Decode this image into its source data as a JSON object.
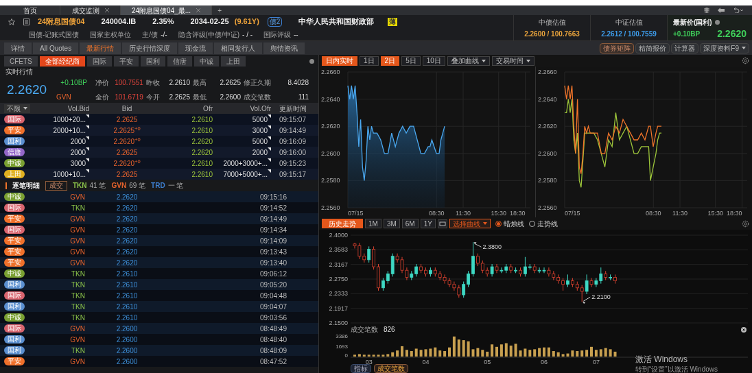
{
  "top_tabs": [
    {
      "label": "首页",
      "closable": false,
      "selected": false
    },
    {
      "label": "成交监测",
      "closable": true,
      "selected": false
    },
    {
      "label": "24附息国债04_最...",
      "closable": true,
      "selected": true
    }
  ],
  "add_tab": "+",
  "bond": {
    "name": "24附息国债04",
    "code": "240004.IB",
    "coupon": "2.35%",
    "maturity": "2034-02-25",
    "term": "(9.61Y)",
    "tag": "债2",
    "issuer": "中华人民共和国财政部",
    "issuer_badge": "薄"
  },
  "bond_info": [
    {
      "label": "国债-记账式国债"
    },
    {
      "label": "国家主权单位"
    },
    {
      "label": "主/债",
      "value": "-/-"
    },
    {
      "label": "隐含评级(中债/中证)",
      "value": "- / -"
    },
    {
      "label": "国际评级",
      "value": "--"
    }
  ],
  "valuations": [
    {
      "label": "中债估值",
      "value": "2.2600 / 100.7663",
      "color": "#e8a33c"
    },
    {
      "label": "中证估值",
      "value": "2.2612 / 100.7559",
      "color": "#3d9be9"
    }
  ],
  "latest": {
    "label": "最新价(国利)",
    "change": "+0.10BP",
    "price": "2.2620"
  },
  "tabs": [
    {
      "label": "详情",
      "selected": false
    },
    {
      "label": "All Quotes",
      "selected": false
    },
    {
      "label": "最新行情",
      "selected": true
    },
    {
      "label": "历史行情深度",
      "selected": false
    },
    {
      "label": "现金流",
      "selected": false
    },
    {
      "label": "相同发行人",
      "selected": false
    },
    {
      "label": "舆情资讯",
      "selected": false
    }
  ],
  "tools": [
    {
      "label": "债券矩阵",
      "highlighted": true,
      "dropdown": false
    },
    {
      "label": "精简报价",
      "highlighted": false,
      "dropdown": false
    },
    {
      "label": "计算器",
      "highlighted": false,
      "dropdown": false
    },
    {
      "label": "深度资料F9",
      "highlighted": false,
      "dropdown": true
    }
  ],
  "brokers": [
    {
      "label": "CFETS",
      "selected": false
    },
    {
      "label": "全部经纪商",
      "selected": true
    },
    {
      "label": "国际",
      "selected": false
    },
    {
      "label": "平安",
      "selected": false
    },
    {
      "label": "国利",
      "selected": false
    },
    {
      "label": "信唐",
      "selected": false
    },
    {
      "label": "中诚",
      "selected": false
    },
    {
      "label": "上田",
      "selected": false
    }
  ],
  "realtime": {
    "title": "实时行情",
    "price": "2.2620",
    "change": "+0.10BP",
    "side": "GVN",
    "stats": [
      {
        "label": "净价",
        "value": "100.7551",
        "kind": "price"
      },
      {
        "label": "昨收",
        "value": "2.2610",
        "kind": "plain"
      },
      {
        "label": "最高",
        "value": "2.2625",
        "kind": "plain"
      },
      {
        "label": "修正久期",
        "value": "8.4028",
        "kind": "plain"
      },
      {
        "label": "全价",
        "value": "101.6719",
        "kind": "price"
      },
      {
        "label": "今开",
        "value": "2.2625",
        "kind": "plain"
      },
      {
        "label": "最低",
        "value": "2.2600",
        "kind": "plain"
      },
      {
        "label": "成交笔数",
        "value": "111",
        "kind": "plain"
      }
    ]
  },
  "quotes": {
    "filter": "不限",
    "columns": [
      "Vol.Bid",
      "Bid",
      "Ofr",
      "Vol.Ofr",
      "更新时间"
    ],
    "rows": [
      {
        "broker": "国际",
        "color": "#d9646e",
        "vol_bid": "1000+20...",
        "bid": "2.2625",
        "ofr": "2.2610",
        "vol_ofr": "5000",
        "time": "09:15:07"
      },
      {
        "broker": "平安",
        "color": "#f0702a",
        "vol_bid": "2000+10...",
        "bid": "2.2625$^{+0}$",
        "ofr": "2.2610",
        "vol_ofr": "3000",
        "time": "09:14:49"
      },
      {
        "broker": "国利",
        "color": "#5a8fd0",
        "vol_bid": "2000",
        "bid": "2.2620$^{+0}$",
        "ofr": "2.2620",
        "vol_ofr": "5000",
        "time": "09:16:09"
      },
      {
        "broker": "信唐",
        "color": "#9366c8",
        "vol_bid": "2000",
        "bid": "2.2625",
        "ofr": "2.2620",
        "vol_ofr": "2000",
        "time": "09:16:00"
      },
      {
        "broker": "中诚",
        "color": "#7aa032",
        "vol_bid": "3000",
        "bid": "2.2620$^{+0}$",
        "ofr": "2.2610",
        "vol_ofr": "2000+3000+...",
        "time": "09:15:23"
      },
      {
        "broker": "上田",
        "color": "#e0b020",
        "vol_bid": "1000+10...",
        "bid": "2.2625",
        "ofr": "2.2610",
        "vol_ofr": "7000+5000+...",
        "time": "09:15:17"
      }
    ]
  },
  "trades": {
    "title": "逐笔明细",
    "button": "成交",
    "summary": [
      {
        "side": "TKN",
        "count": "41 笔",
        "color": "#8bc34a"
      },
      {
        "side": "GVN",
        "count": "69 笔",
        "color": "#e8632c"
      },
      {
        "side": "TRD",
        "count": "一 笔",
        "color": "#3d7fd0"
      }
    ],
    "rows": [
      {
        "broker": "中诚",
        "color": "#7aa032",
        "side": "GVN",
        "kind": "given",
        "price": "2.2620",
        "time": "09:15:16"
      },
      {
        "broker": "国际",
        "color": "#d9646e",
        "side": "TKN",
        "kind": "taken",
        "price": "2.2620",
        "time": "09:14:52"
      },
      {
        "broker": "平安",
        "color": "#f0702a",
        "side": "GVN",
        "kind": "given",
        "price": "2.2620",
        "time": "09:14:49"
      },
      {
        "broker": "国际",
        "color": "#d9646e",
        "side": "GVN",
        "kind": "given",
        "price": "2.2620",
        "time": "09:14:34"
      },
      {
        "broker": "平安",
        "color": "#f0702a",
        "side": "GVN",
        "kind": "given",
        "price": "2.2620",
        "time": "09:14:09"
      },
      {
        "broker": "平安",
        "color": "#f0702a",
        "side": "GVN",
        "kind": "given",
        "price": "2.2620",
        "time": "09:13:43"
      },
      {
        "broker": "平安",
        "color": "#f0702a",
        "side": "GVN",
        "kind": "given",
        "price": "2.2620",
        "time": "09:13:40"
      },
      {
        "broker": "中诚",
        "color": "#7aa032",
        "side": "TKN",
        "kind": "taken",
        "price": "2.2610",
        "time": "09:06:12"
      },
      {
        "broker": "国利",
        "color": "#5a8fd0",
        "side": "TKN",
        "kind": "taken",
        "price": "2.2610",
        "time": "09:05:20"
      },
      {
        "broker": "国际",
        "color": "#d9646e",
        "side": "TKN",
        "kind": "taken",
        "price": "2.2610",
        "time": "09:04:48"
      },
      {
        "broker": "国利",
        "color": "#5a8fd0",
        "side": "TKN",
        "kind": "taken",
        "price": "2.2610",
        "time": "09:04:07"
      },
      {
        "broker": "中诚",
        "color": "#7aa032",
        "side": "TKN",
        "kind": "taken",
        "price": "2.2610",
        "time": "09:03:56"
      },
      {
        "broker": "国际",
        "color": "#d9646e",
        "side": "GVN",
        "kind": "given",
        "price": "2.2600",
        "time": "08:48:49"
      },
      {
        "broker": "国利",
        "color": "#5a8fd0",
        "side": "GVN",
        "kind": "given",
        "price": "2.2600",
        "time": "08:48:40"
      },
      {
        "broker": "国利",
        "color": "#5a8fd0",
        "side": "TKN",
        "kind": "taken",
        "price": "2.2600",
        "time": "08:48:09"
      },
      {
        "broker": "平安",
        "color": "#f0702a",
        "side": "GVN",
        "kind": "given",
        "price": "2.2600",
        "time": "08:47:52"
      }
    ]
  },
  "intraday": {
    "ranges": [
      {
        "label": "日内实时",
        "selected": true
      },
      {
        "label": "1日",
        "selected": false
      },
      {
        "label": "2日",
        "selected": true
      },
      {
        "label": "5日",
        "selected": false
      },
      {
        "label": "10日",
        "selected": false
      }
    ],
    "menus": [
      "叠加曲线",
      "交易时间"
    ],
    "charts": [
      {
        "chart_data": {
          "type": "area",
          "grid": true,
          "x": [
            -1.5,
            -1.29,
            -1.09,
            -0.88,
            -0.68,
            -0.47,
            -0.27,
            -0.06,
            0.15,
            0.35,
            0.56,
            0.76,
            0.97,
            1.17,
            1.38,
            1.59,
            1.79,
            2.2,
            2.62,
            3.03,
            3.44,
            3.85,
            4.26,
            4.67,
            5.08,
            5.5,
            5.91,
            6.32,
            6.73,
            7.14,
            7.55,
            7.76,
            7.97,
            8.48,
            8.79,
            8.99,
            9.2,
            9.41
          ],
          "xlim": [
            -1.5,
            19.08
          ],
          "ylim": [
            2.256,
            2.266
          ],
          "xticks": [
            {
              "value": -1.5,
              "label": "07/15"
            },
            {
              "value": 8.5,
              "label": "08:30"
            },
            {
              "value": 11.5,
              "label": "11:30"
            },
            {
              "value": 15.5,
              "label": "15:30"
            },
            {
              "value": 18.5,
              "label": "18:30"
            }
          ],
          "yticks": [
            {
              "value": 2.256,
              "label": "2.2560"
            },
            {
              "value": 2.258,
              "label": "2.2580"
            },
            {
              "value": 2.26,
              "label": "2.2600"
            },
            {
              "value": 2.262,
              "label": "2.2620"
            },
            {
              "value": 2.264,
              "label": "2.2640"
            },
            {
              "value": 2.266,
              "label": "2.2660"
            }
          ],
          "series": [
            {
              "color": "#4aa8f0",
              "values": [
                2.265,
                2.264,
                2.265,
                2.264,
                2.265,
                2.263,
                2.2605,
                2.2625,
                2.259,
                2.258,
                2.2595,
                2.262,
                2.261,
                2.262,
                2.2615,
                2.2615,
                2.2615,
                2.261,
                2.26,
                2.26,
                2.2615,
                2.2605,
                2.2615,
                2.262,
                2.2615,
                2.262,
                2.262,
                2.261,
                2.26,
                2.26,
                2.2605,
                2.2605,
                2.261,
                2.26,
                2.26,
                2.261,
                2.2615,
                2.262
              ]
            }
          ]
        }
      },
      {
        "chart_data": {
          "type": "line",
          "grid": true,
          "x": [
            -1.5,
            -1.29,
            -1.09,
            -0.88,
            -0.68,
            -0.47,
            -0.27,
            -0.06,
            0.15,
            0.35,
            0.56,
            0.76,
            0.97,
            1.17,
            1.38,
            1.59,
            1.79,
            2.2,
            2.62,
            3.03,
            3.44,
            3.85,
            4.26,
            4.67,
            5.08,
            5.5,
            5.91,
            6.32,
            6.73,
            7.14,
            7.55,
            7.76,
            7.97,
            8.17,
            8.48,
            8.79,
            8.99,
            9.2,
            9.41
          ],
          "xlim": [
            -1.5,
            19.08
          ],
          "ylim": [
            2.256,
            2.266
          ],
          "xticks": [
            {
              "value": -1.5,
              "label": "07/15"
            },
            {
              "value": 8.5,
              "label": "08:30"
            },
            {
              "value": 11.5,
              "label": "11:30"
            },
            {
              "value": 15.5,
              "label": "15:30"
            },
            {
              "value": 18.5,
              "label": "18:30"
            }
          ],
          "yticks": [
            {
              "value": 2.256,
              "label": "2.2560"
            },
            {
              "value": 2.258,
              "label": "2.2580"
            },
            {
              "value": 2.26,
              "label": "2.2600"
            },
            {
              "value": 2.262,
              "label": "2.2620"
            },
            {
              "value": 2.264,
              "label": "2.2640"
            },
            {
              "value": 2.266,
              "label": "2.2660"
            }
          ],
          "series": [
            {
              "color": "#9cc43a",
              "values": [
                2.263,
                2.263,
                2.264,
                2.263,
                2.264,
                2.261,
                2.26,
                2.2615,
                2.258,
                2.2575,
                2.2595,
                2.2615,
                2.2615,
                2.2615,
                2.2615,
                2.2615,
                2.2615,
                2.261,
                2.26,
                2.259,
                2.261,
                2.2605,
                2.263,
                2.261,
                2.2615,
                2.262,
                2.261,
                2.26,
                2.26,
                2.2605,
                2.2605,
                2.2605,
                2.2605,
                2.258,
                2.259,
                2.26,
                2.261,
                2.2615,
                2.2615
              ]
            },
            {
              "color": "#f2752a",
              "values": [
                2.265,
                2.264,
                2.265,
                2.264,
                2.265,
                2.262,
                2.26,
                2.264,
                2.259,
                2.2585,
                2.26,
                2.262,
                2.2615,
                2.262,
                2.2615,
                2.2615,
                2.2615,
                2.2615,
                2.26,
                2.26,
                2.2615,
                2.261,
                2.262,
                2.2615,
                2.2625,
                2.262,
                2.2615,
                2.261,
                2.261,
                2.2615,
                2.261,
                2.2615,
                2.262,
                2.262,
                2.2605,
                2.2615,
                2.262,
                2.262,
                2.262
              ]
            }
          ]
        }
      }
    ]
  },
  "history": {
    "title": "历史走势",
    "ranges": [
      {
        "label": "1M",
        "selected": false
      },
      {
        "label": "3M",
        "selected": false
      },
      {
        "label": "6M",
        "selected": false
      },
      {
        "label": "1Y",
        "selected": false
      }
    ],
    "curve_menu": "选择曲线",
    "modes": [
      {
        "label": "蜡烛线",
        "selected": true
      },
      {
        "label": "走势线",
        "selected": false
      }
    ],
    "chart_data": {
      "type": "candlestick",
      "ylim": [
        2.15,
        2.4
      ],
      "grid": true,
      "yticks": [
        {
          "value": 2.4,
          "label": "2.4000"
        },
        {
          "value": 2.3583,
          "label": "2.3583"
        },
        {
          "value": 2.3167,
          "label": "2.3167"
        },
        {
          "value": 2.275,
          "label": "2.2750"
        },
        {
          "value": 2.2333,
          "label": "2.2333"
        },
        {
          "value": 2.1917,
          "label": "2.1917"
        },
        {
          "value": 2.15,
          "label": "2.1500"
        }
      ],
      "annotations": [
        {
          "text": "2.3800"
        },
        {
          "text": "2.2100"
        }
      ],
      "ohlc": [
        [
          2.375,
          2.378,
          2.362,
          2.37
        ],
        [
          2.37,
          2.378,
          2.332,
          2.34
        ],
        [
          2.34,
          2.348,
          2.322,
          2.33
        ],
        [
          2.33,
          2.368,
          2.322,
          2.36
        ],
        [
          2.36,
          2.368,
          2.302,
          2.31
        ],
        [
          2.31,
          2.318,
          2.242,
          2.25
        ],
        [
          2.25,
          2.278,
          2.242,
          2.27
        ],
        [
          2.27,
          2.298,
          2.262,
          2.29
        ],
        [
          2.29,
          2.348,
          2.282,
          2.34
        ],
        [
          2.34,
          2.348,
          2.322,
          2.33
        ],
        [
          2.33,
          2.338,
          2.292,
          2.3
        ],
        [
          2.3,
          2.308,
          2.272,
          2.28
        ],
        [
          2.28,
          2.298,
          2.272,
          2.29
        ],
        [
          2.29,
          2.318,
          2.282,
          2.31
        ],
        [
          2.31,
          2.318,
          2.292,
          2.3
        ],
        [
          2.3,
          2.308,
          2.282,
          2.29
        ],
        [
          2.29,
          2.308,
          2.282,
          2.3
        ],
        [
          2.3,
          2.308,
          2.282,
          2.29
        ],
        [
          2.29,
          2.298,
          2.272,
          2.28
        ],
        [
          2.28,
          2.288,
          2.262,
          2.27
        ],
        [
          2.27,
          2.278,
          2.252,
          2.26
        ],
        [
          2.26,
          2.268,
          2.242,
          2.25
        ],
        [
          2.25,
          2.258,
          2.222,
          2.23
        ],
        [
          2.23,
          2.268,
          2.222,
          2.26
        ],
        [
          2.26,
          2.298,
          2.252,
          2.29
        ],
        [
          2.29,
          2.38,
          2.282,
          2.34
        ],
        [
          2.34,
          2.348,
          2.312,
          2.32
        ],
        [
          2.32,
          2.328,
          2.292,
          2.3
        ],
        [
          2.3,
          2.308,
          2.282,
          2.29
        ],
        [
          2.29,
          2.318,
          2.282,
          2.31
        ],
        [
          2.31,
          2.318,
          2.292,
          2.3
        ],
        [
          2.3,
          2.308,
          2.292,
          2.3
        ],
        [
          2.3,
          2.318,
          2.292,
          2.31
        ],
        [
          2.31,
          2.318,
          2.292,
          2.3
        ],
        [
          2.3,
          2.308,
          2.292,
          2.3
        ],
        [
          2.3,
          2.308,
          2.282,
          2.29
        ],
        [
          2.29,
          2.338,
          2.282,
          2.31
        ],
        [
          2.31,
          2.318,
          2.302,
          2.31
        ],
        [
          2.31,
          2.318,
          2.292,
          2.3
        ],
        [
          2.3,
          2.308,
          2.292,
          2.3
        ],
        [
          2.3,
          2.308,
          2.292,
          2.3
        ],
        [
          2.3,
          2.308,
          2.282,
          2.29
        ],
        [
          2.29,
          2.298,
          2.272,
          2.28
        ],
        [
          2.28,
          2.288,
          2.262,
          2.27
        ],
        [
          2.27,
          2.278,
          2.242,
          2.26
        ],
        [
          2.26,
          2.288,
          2.252,
          2.27
        ],
        [
          2.27,
          2.278,
          2.252,
          2.26
        ],
        [
          2.26,
          2.268,
          2.242,
          2.25
        ],
        [
          2.25,
          2.258,
          2.21,
          2.24
        ],
        [
          2.24,
          2.288,
          2.232,
          2.27
        ],
        [
          2.27,
          2.278,
          2.252,
          2.26
        ],
        [
          2.26,
          2.278,
          2.252,
          2.27
        ],
        [
          2.27,
          2.308,
          2.262,
          2.29
        ],
        [
          2.29,
          2.298,
          2.272,
          2.28
        ],
        [
          2.28,
          2.288,
          2.272,
          2.28
        ],
        [
          2.28,
          2.288,
          2.262,
          2.27
        ]
      ]
    },
    "volume": {
      "label": "成交笔数",
      "value": "826",
      "chart_data": {
        "type": "bar",
        "ylim": [
          0,
          3386
        ],
        "categories": [
          null,
          null,
          null,
          "03",
          null,
          null,
          null,
          null,
          null,
          null,
          null,
          null,
          null,
          null,
          null,
          "04",
          null,
          null,
          null,
          null,
          null,
          null,
          null,
          null,
          null,
          null,
          null,
          null,
          "05",
          null,
          null,
          null,
          null,
          null,
          null,
          null,
          null,
          null,
          null,
          null,
          "06",
          null,
          null,
          null,
          null,
          null,
          null,
          null,
          null,
          null,
          null,
          "07",
          null,
          null,
          null,
          null
        ],
        "yticks": [
          {
            "value": 3386,
            "label": "3386"
          },
          {
            "value": 1693,
            "label": "1693"
          },
          {
            "value": 0,
            "label": "0"
          }
        ],
        "values": [
          300,
          400,
          300,
          300,
          300,
          300,
          300,
          400,
          700,
          1000,
          1700,
          1100,
          900,
          1300,
          1100,
          1200,
          1300,
          1500,
          1000,
          900,
          1500,
          3300,
          2800,
          2700,
          2500,
          1200,
          1400,
          1100,
          800,
          2000,
          1600,
          2000,
          2200,
          1800,
          2100,
          1000,
          1300,
          1100,
          1200,
          1400,
          1500,
          1500,
          900,
          700,
          400,
          500,
          1000,
          900,
          1000,
          1100,
          1600,
          1100,
          1200,
          1400,
          1200,
          800
        ]
      }
    },
    "indicators": [
      {
        "label": "指标",
        "selected": false
      },
      {
        "label": "成交笔数",
        "selected": true
      }
    ]
  },
  "os_notice": {
    "title": "激活 Windows",
    "text": "转到“设置”以激活 Windows"
  }
}
